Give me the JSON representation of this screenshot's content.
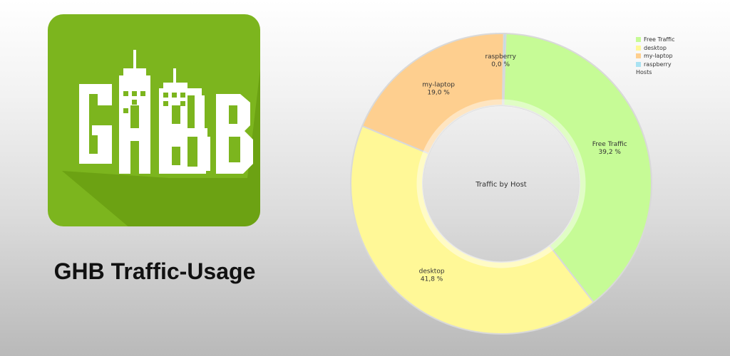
{
  "app": {
    "title": "GHB Traffic-Usage",
    "logo": {
      "text": "GHB",
      "background": "#7cb51e",
      "shadow": "#6aa012"
    }
  },
  "chart_data": {
    "type": "pie",
    "donut": true,
    "title": "Traffic by Host",
    "legend_title": "Hosts",
    "legend_position": "top-right",
    "slices": [
      {
        "label": "Free Traffic",
        "value": 39.2,
        "display": "39,2 %",
        "color": "#c6fb96"
      },
      {
        "label": "desktop",
        "value": 41.8,
        "display": "41,8 %",
        "color": "#fff897"
      },
      {
        "label": "my-laptop",
        "value": 19.0,
        "display": "19,0 %",
        "color": "#fecf8f"
      },
      {
        "label": "raspberry",
        "value": 0.0,
        "display": "0,0 %",
        "color": "#a9e2f2"
      }
    ]
  }
}
